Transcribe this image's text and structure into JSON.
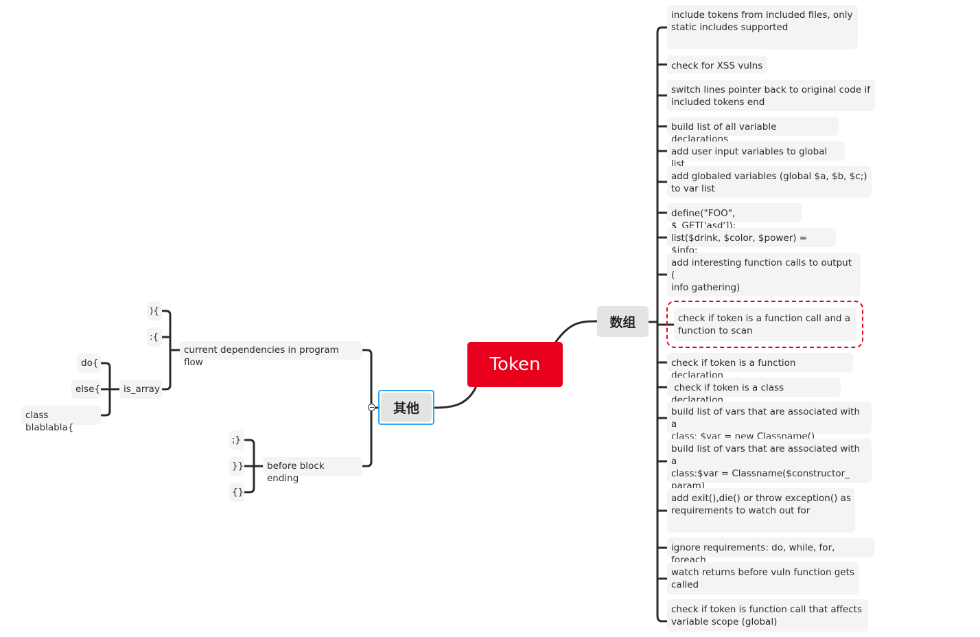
{
  "root": {
    "label": "Token",
    "color": "#e8001c"
  },
  "right_branch": {
    "label": "数组",
    "items": [
      "include tokens from included files, only\nstatic includes supported",
      "check for XSS vulns",
      "switch lines pointer back to original code if\nincluded tokens end",
      "build list of all variable declarations",
      "add user input variables to global list",
      "add globaled variables (global $a, $b, $c;)\nto var list",
      "define(\"FOO\", $_GET['asd']);",
      "list($drink, $color, $power) = $info;",
      "add interesting function calls to output (\ninfo gathering)",
      "check if token is a function call and a\nfunction to scan",
      "check if token is a function declaration",
      " check if token is a class declaration",
      "build list of vars that are associated with a\nclass: $var = new Classname()",
      "build list of vars that are associated with a\nclass:$var = Classname($constructor_\nparam)",
      "add exit(),die() or throw exception() as\nrequirements to watch out for",
      "ignore requirements: do, while, for, foreach",
      "watch returns before vuln function gets\ncalled",
      "check if token is function call that affects\nvariable scope (global)"
    ],
    "highlighted_item_color": "#e8001c"
  },
  "left_branch": {
    "label": "其他",
    "selected_color": "#2ea7f0",
    "current_dependencies": {
      "label": "current dependencies in program flow",
      "children": [
        "){",
        ":{"
      ],
      "is_array": {
        "label": "is_array",
        "children": [
          "do{",
          "else{",
          "class blablabla{"
        ]
      }
    },
    "before_block_ending": {
      "label": "before block ending",
      "children": [
        ";}",
        "}}",
        "{}"
      ]
    }
  }
}
